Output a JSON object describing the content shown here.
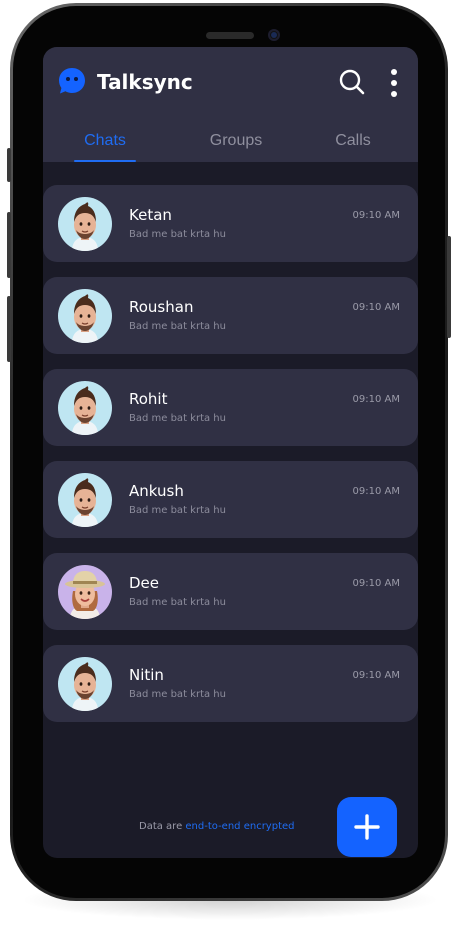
{
  "app": {
    "title": "Talksync"
  },
  "header": {
    "search_icon": "search-icon",
    "more_icon": "more-vertical-icon"
  },
  "tabs": [
    {
      "label": "Chats",
      "active": true
    },
    {
      "label": "Groups",
      "active": false
    },
    {
      "label": "Calls",
      "active": false
    }
  ],
  "chats": [
    {
      "name": "Ketan",
      "message": "Bad me bat krta hu",
      "time": "09:10 AM",
      "avatar": "male-memoji"
    },
    {
      "name": "Roushan",
      "message": "Bad me bat krta hu",
      "time": "09:10 AM",
      "avatar": "male-memoji"
    },
    {
      "name": "Rohit",
      "message": "Bad me bat krta hu",
      "time": "09:10 AM",
      "avatar": "male-memoji"
    },
    {
      "name": "Ankush",
      "message": "Bad me bat krta hu",
      "time": "09:10 AM",
      "avatar": "male-memoji"
    },
    {
      "name": "Dee",
      "message": "Bad me bat krta hu",
      "time": "09:10 AM",
      "avatar": "female-memoji"
    },
    {
      "name": "Nitin",
      "message": "Bad me bat krta hu",
      "time": "09:10 AM",
      "avatar": "male-memoji"
    }
  ],
  "footer": {
    "prefix": "Data are ",
    "link": "end-to-end encrypted"
  },
  "fab": {
    "icon": "plus-icon"
  },
  "colors": {
    "accent": "#1f6cf2",
    "fab": "#1463ff",
    "background": "#1b1b28",
    "card": "#303044",
    "text": "#ffffff",
    "muted": "#8c8c9c"
  }
}
